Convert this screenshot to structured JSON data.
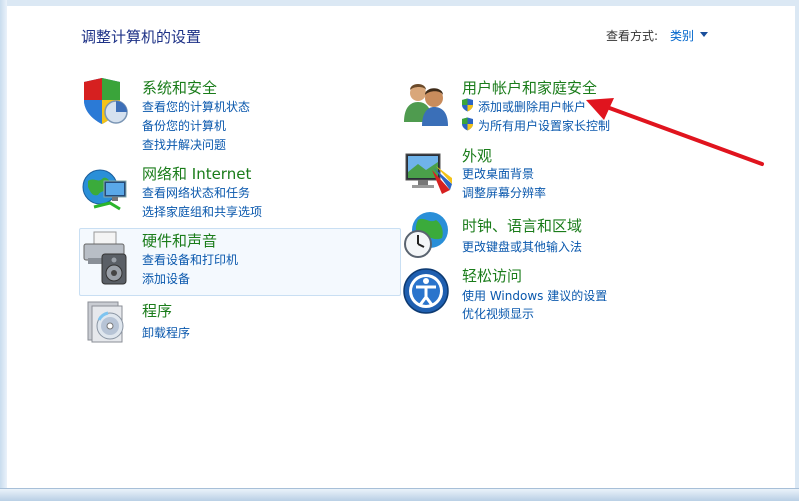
{
  "header": {
    "title": "调整计算机的设置",
    "view_by_label": "查看方式:",
    "view_by_value": "类别"
  },
  "categories_left": [
    {
      "title": "系统和安全",
      "icon": "security-shield-icon",
      "links": [
        "查看您的计算机状态",
        "备份您的计算机",
        "查找并解决问题"
      ]
    },
    {
      "title": "网络和 Internet",
      "icon": "network-globe-icon",
      "links": [
        "查看网络状态和任务",
        "选择家庭组和共享选项"
      ]
    },
    {
      "title": "硬件和声音",
      "icon": "printer-speaker-icon",
      "links": [
        "查看设备和打印机",
        "添加设备"
      ]
    },
    {
      "title": "程序",
      "icon": "programs-disc-icon",
      "links": [
        "卸载程序"
      ]
    }
  ],
  "categories_right": [
    {
      "title": "用户帐户和家庭安全",
      "icon": "users-icon",
      "links": [
        "添加或删除用户帐户",
        "为所有用户设置家长控制"
      ]
    },
    {
      "title": "外观",
      "icon": "appearance-monitor-icon",
      "links": [
        "更改桌面背景",
        "调整屏幕分辨率"
      ]
    },
    {
      "title": "时钟、语言和区域",
      "icon": "clock-globe-icon",
      "links": [
        "更改键盘或其他输入法"
      ]
    },
    {
      "title": "轻松访问",
      "icon": "ease-of-access-icon",
      "links": [
        "使用 Windows 建议的设置",
        "优化视频显示"
      ]
    }
  ],
  "colors": {
    "title_green": "#1a7c1a",
    "link_blue": "#0a58ad",
    "header_blue": "#1e3287",
    "annotation_red": "#e0141e"
  }
}
